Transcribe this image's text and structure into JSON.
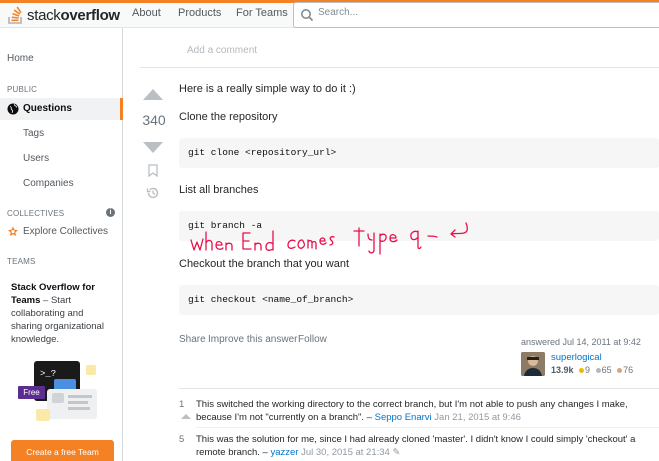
{
  "header": {
    "logo_prefix": "stack",
    "logo_suffix": "overflow",
    "nav_about": "About",
    "nav_products": "Products",
    "nav_for_teams": "For Teams",
    "search_placeholder": "Search..."
  },
  "sidebar": {
    "home": "Home",
    "public_heading": "PUBLIC",
    "questions": "Questions",
    "tags": "Tags",
    "users": "Users",
    "companies": "Companies",
    "collectives_heading": "COLLECTIVES",
    "explore_collectives": "Explore Collectives",
    "teams_heading": "TEAMS",
    "teams_title": "Stack Overflow for Teams",
    "teams_desc": " – Start collaborating and sharing organizational knowledge.",
    "free_badge": "Free",
    "create_team": "Create a free Team"
  },
  "answer": {
    "add_comment": "Add a comment",
    "votes": "340",
    "intro": "Here is a really simple way to do it :)",
    "step1": "Clone the repository",
    "code1": "git clone <repository_url>",
    "step2": "List all branches",
    "code2": "git branch -a",
    "handwritten_note": "when End comes type q",
    "step3": "Checkout the branch that you want",
    "code3": "git checkout <name_of_branch>",
    "share": "Share",
    "improve": "Improve this answer",
    "follow": "Follow",
    "answered": "answered Jul 14, 2011 at 9:42",
    "author": "superlogical",
    "reputation": "13.9k",
    "gold": "9",
    "silver": "65",
    "bronze": "76"
  },
  "comments": [
    {
      "score": "1",
      "text": "This switched the working directory to the correct branch, but I'm not able to push any changes I make, because I'm not \"currently on a branch\". – ",
      "user": "Seppo Enarvi",
      "date": " Jan 21, 2015 at 9:46"
    },
    {
      "score": "5",
      "text": "This was the solution for me, since I had already cloned 'master'. I didn't know I could simply 'checkout' a remote branch. – ",
      "user": "yazzer",
      "date": " Jul 30, 2015 at 21:34 ✎"
    }
  ],
  "colors": {
    "accent": "#f48225",
    "link": "#0074cc",
    "handwriting": "#e8104a"
  }
}
